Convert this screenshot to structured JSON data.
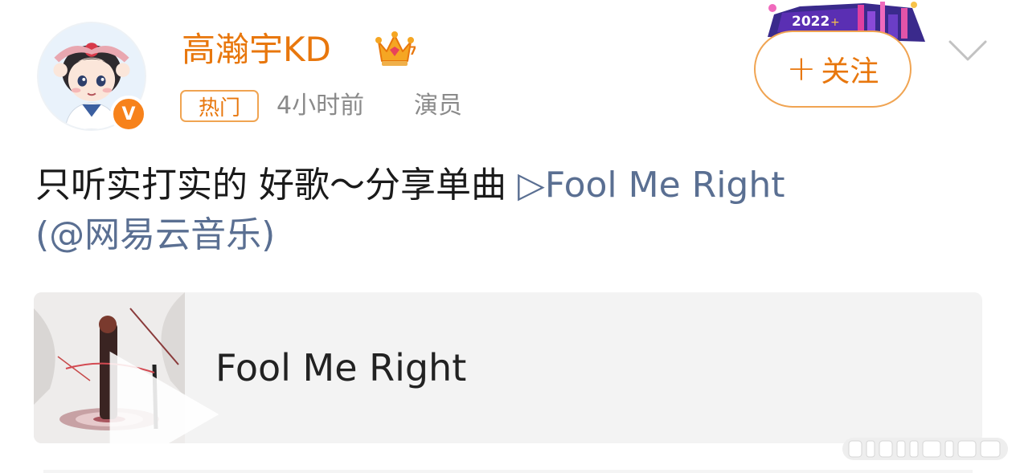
{
  "header": {
    "username": "高瀚宇KD",
    "badge_hot": "热门",
    "time": "4小时前",
    "role": "演员",
    "follow_label": "关注",
    "follow_icon": "plus-icon",
    "banner_year": "2022",
    "verified_mark": "V"
  },
  "post": {
    "text": "只听实打实的 好歌～分享单曲 ",
    "song_link": "▷Fool Me Right",
    "source_link": "(@网易云音乐)"
  },
  "music_card": {
    "title": "Fool Me Right",
    "play_icon": "play-icon"
  },
  "colors": {
    "accent": "#e8770d",
    "link": "#5a6f92",
    "meta": "#8a8a8a",
    "card_bg": "#f3f3f3"
  }
}
